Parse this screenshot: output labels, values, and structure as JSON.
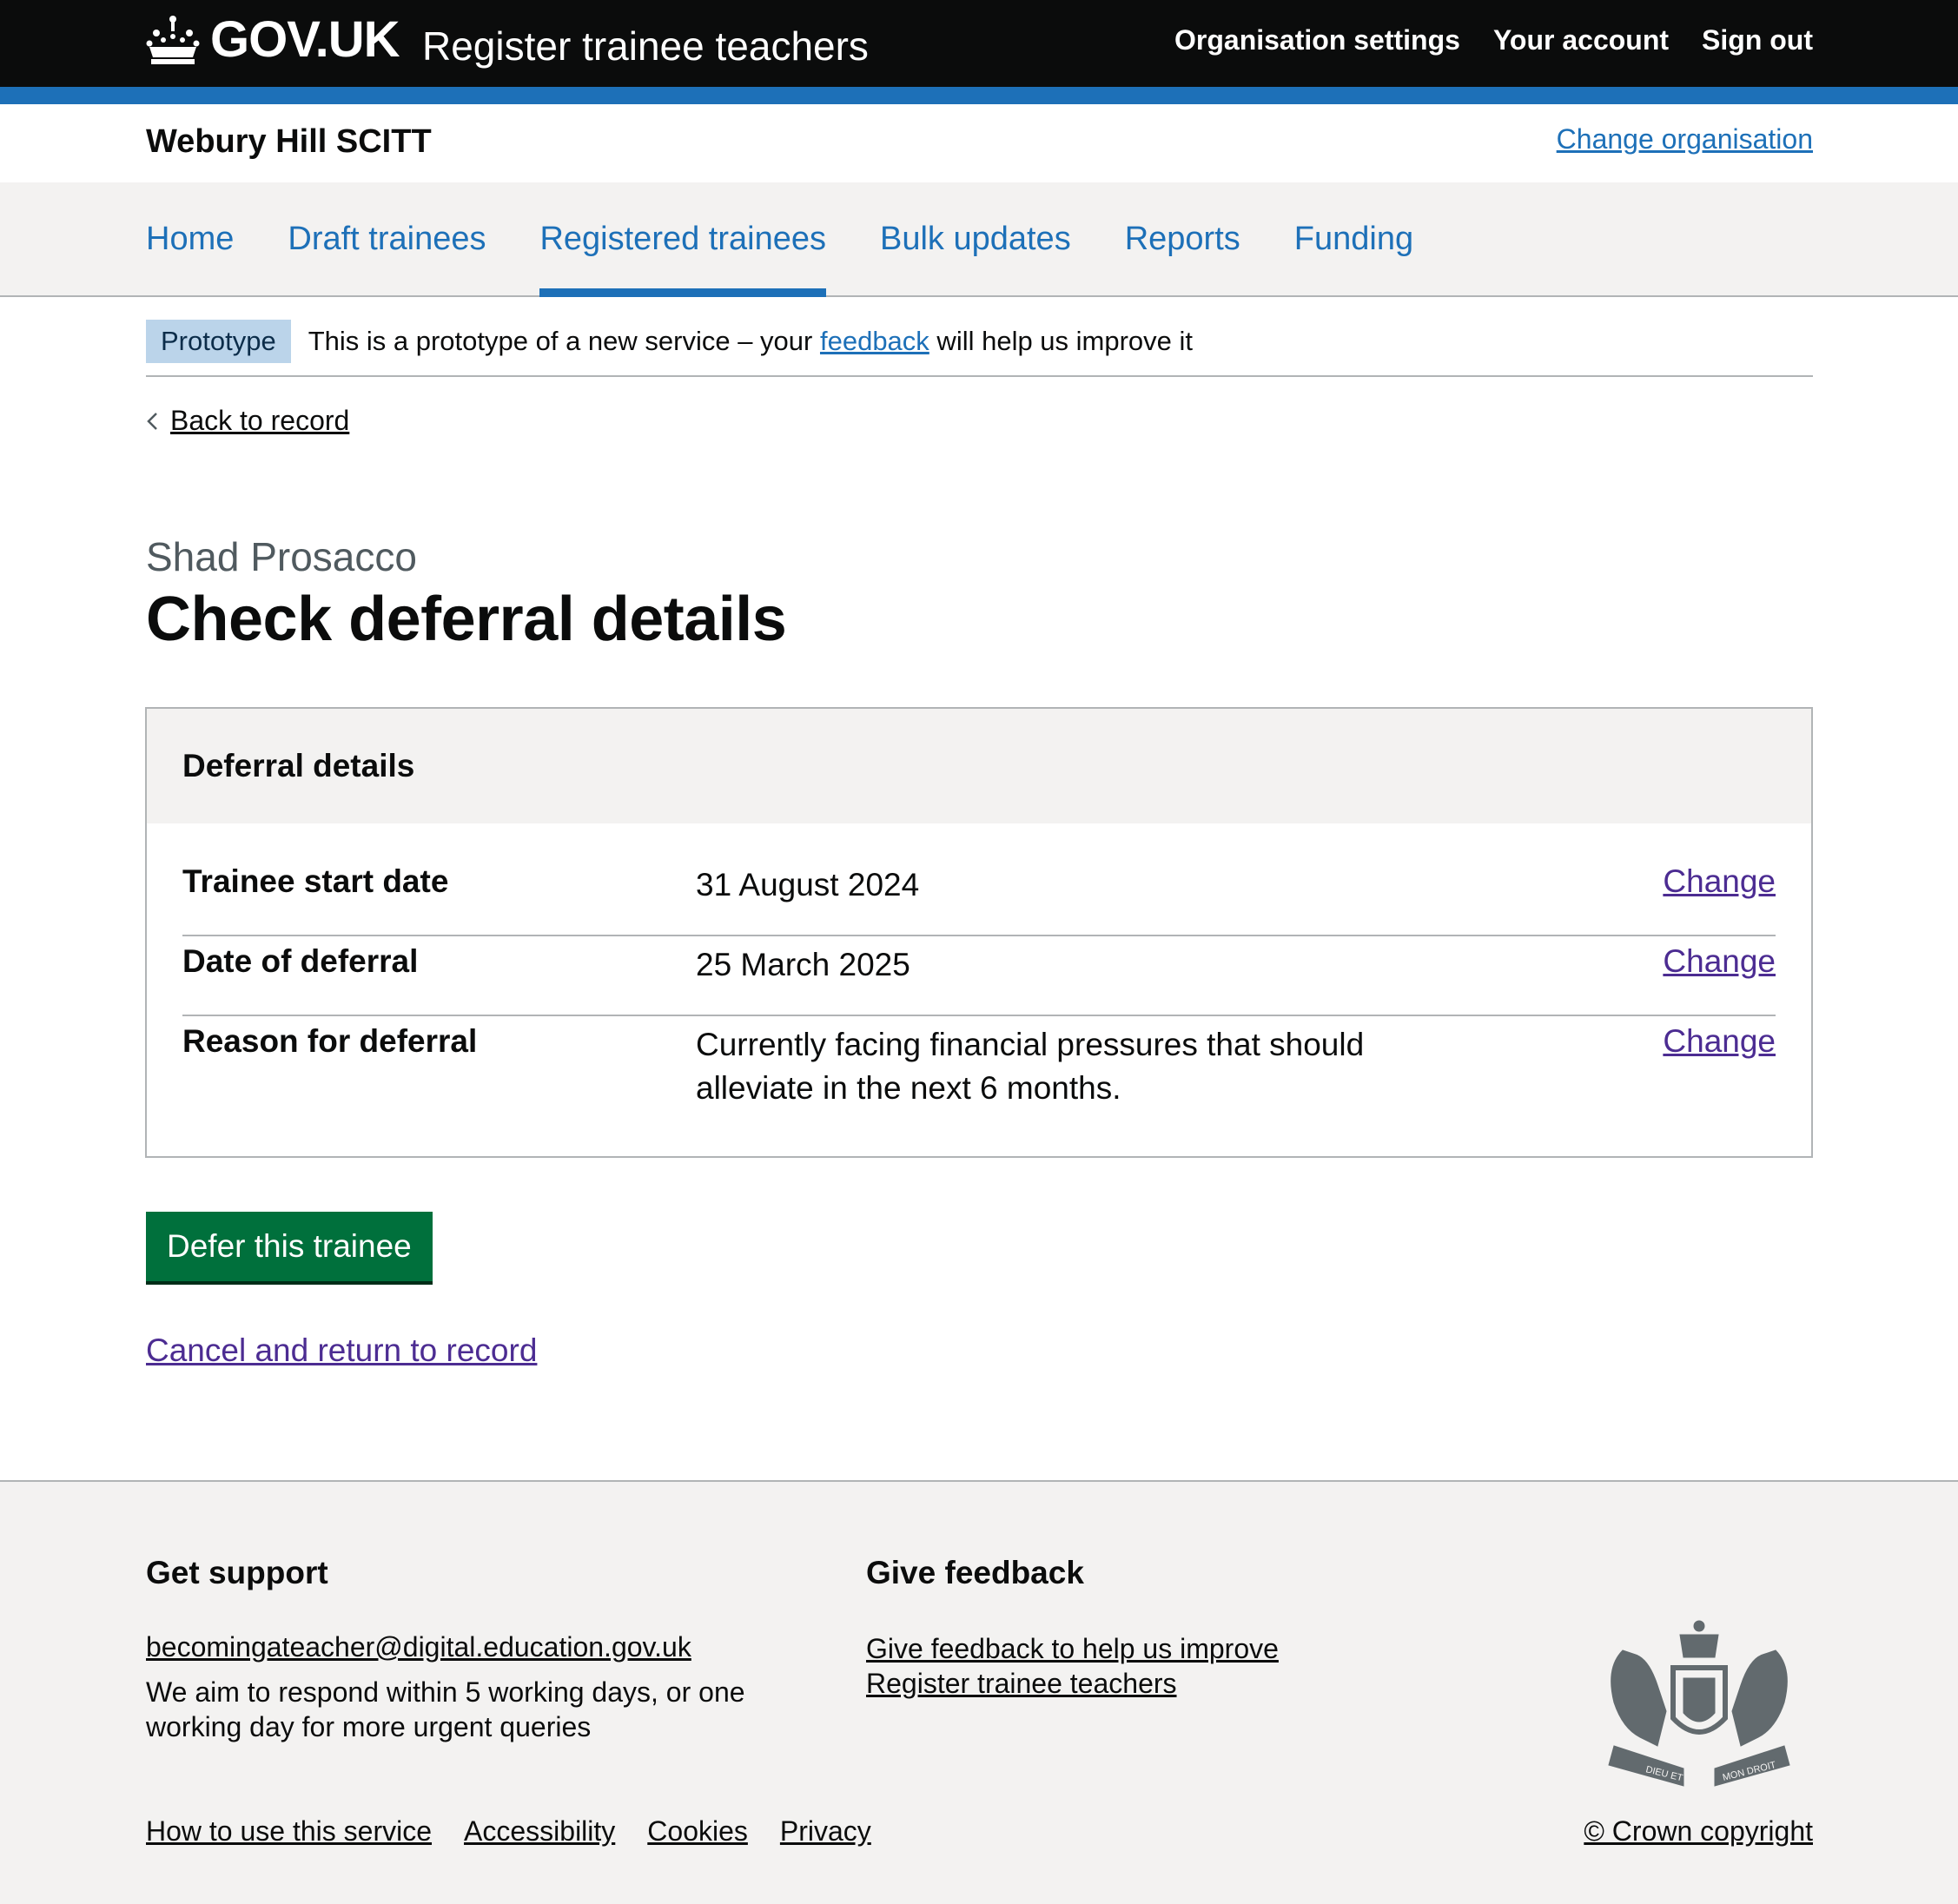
{
  "header": {
    "logo_text": "GOV.UK",
    "service_name": "Register trainee teachers",
    "nav": [
      "Organisation settings",
      "Your account",
      "Sign out"
    ]
  },
  "org": {
    "name": "Webury Hill SCITT",
    "change_label": "Change organisation"
  },
  "primary_nav": {
    "items": [
      "Home",
      "Draft trainees",
      "Registered trainees",
      "Bulk updates",
      "Reports",
      "Funding"
    ],
    "active": "Registered trainees"
  },
  "phase_banner": {
    "tag": "Prototype",
    "text_before": "This is a prototype of a new service – your ",
    "link": "feedback",
    "text_after": " will help us improve it"
  },
  "back_link": "Back to record",
  "page": {
    "caption": "Shad Prosacco",
    "title": "Check deferral details"
  },
  "card": {
    "title": "Deferral details",
    "rows": [
      {
        "key": "Trainee start date",
        "value": "31 August 2024",
        "action": "Change"
      },
      {
        "key": "Date of deferral",
        "value": "25 March 2025",
        "action": "Change"
      },
      {
        "key": "Reason for deferral",
        "value_line1": "Currently facing financial pressures that should",
        "value_line2": "alleviate in the next 6 months.",
        "action": "Change"
      }
    ]
  },
  "button_label": "Defer this trainee",
  "cancel_link": "Cancel and return to record",
  "footer": {
    "support_heading": "Get support",
    "support_email": "becomingateacher@digital.education.gov.uk",
    "support_text": "We aim to respond within 5 working days, or one working day for more urgent queries",
    "feedback_heading": "Give feedback",
    "feedback_link_line1": "Give feedback to help us improve",
    "feedback_link_line2": "Register trainee teachers",
    "links": [
      "How to use this service",
      "Accessibility",
      "Cookies",
      "Privacy"
    ],
    "copyright": "© Crown copyright",
    "crest_motto": [
      "DIEU ET",
      "MON DROIT"
    ]
  },
  "colors": {
    "header_bg": "#0b0c0c",
    "brand_blue": "#1d70b8",
    "button_green": "#00703c",
    "visited_link": "#4c2c92",
    "footer_bg": "#f3f2f1"
  }
}
